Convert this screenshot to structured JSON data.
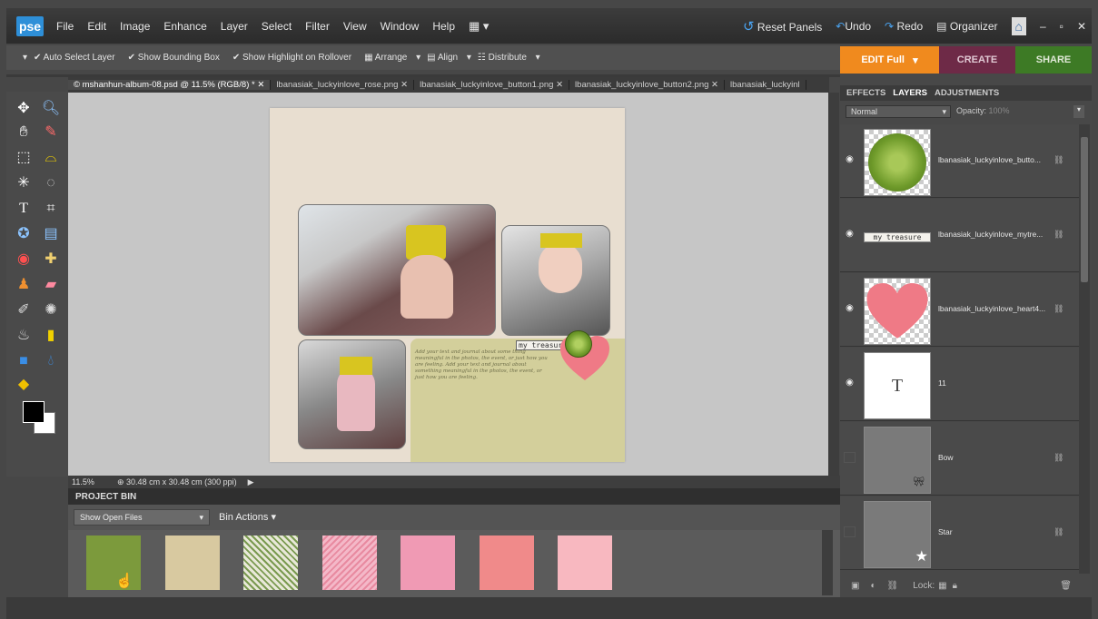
{
  "app": {
    "logo": "pse"
  },
  "menu": [
    "File",
    "Edit",
    "Image",
    "Enhance",
    "Layer",
    "Select",
    "Filter",
    "View",
    "Window",
    "Help"
  ],
  "topbar": {
    "reset_panels": "Reset Panels",
    "undo": "Undo",
    "redo": "Redo",
    "organizer": "Organizer"
  },
  "options": {
    "auto_select": "Auto Select Layer",
    "show_bounding": "Show Bounding Box",
    "show_highlight": "Show Highlight on Rollover",
    "arrange": "Arrange",
    "align": "Align",
    "distribute": "Distribute"
  },
  "modes": {
    "edit": "EDIT Full",
    "create": "CREATE",
    "share": "SHARE"
  },
  "tabs": [
    "© mshanhun-album-08.psd @ 11.5% (RGB/8) *",
    "lbanasiak_luckyinlove_rose.png",
    "lbanasiak_luckyinlove_button1.png",
    "lbanasiak_luckyinlove_button2.png",
    "lbanasiak_luckyinl"
  ],
  "status": {
    "zoom": "11.5%",
    "doc": "30.48 cm x 30.48 cm (300 ppi)"
  },
  "bin": {
    "title": "PROJECT BIN",
    "show": "Show Open Files",
    "actions": "Bin Actions"
  },
  "panel": {
    "tabs": [
      "EFFECTS",
      "LAYERS",
      "ADJUSTMENTS"
    ],
    "blend": "Normal",
    "opacity_label": "Opacity:",
    "opacity": "100%",
    "lock": "Lock:"
  },
  "layers": [
    {
      "name": "lbanasiak_luckyinlove_butto..."
    },
    {
      "name": "lbanasiak_luckyinlove_mytre...",
      "thumb_text": "my treasure"
    },
    {
      "name": "lbanasiak_luckyinlove_heart4..."
    },
    {
      "name": "11",
      "thumb_text": "T"
    },
    {
      "name": "Bow"
    },
    {
      "name": "Star"
    }
  ],
  "doc": {
    "label": "my treasure",
    "journal": "Add your text and journal about some thing meaningful in the photos, the event, or just how you are feeling. Add your text and journal about something meaningful in the photos, the event, or just how you are feeling."
  },
  "colors": {
    "accent_edit": "#f08a1e",
    "create": "#6e2a47",
    "share": "#3d7a25",
    "paper": "#e8ded0",
    "mat": "#d3cf9b"
  }
}
